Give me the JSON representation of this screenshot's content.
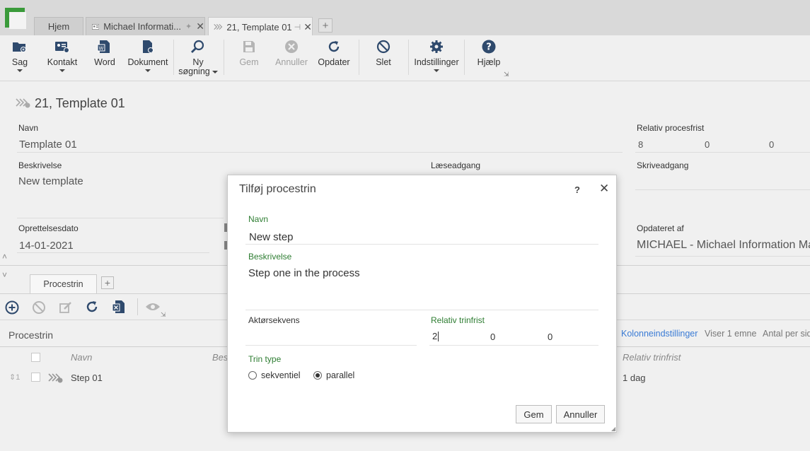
{
  "tabs": [
    {
      "label": "Hjem"
    },
    {
      "label": "Michael Informati..."
    },
    {
      "label": "21, Template 01"
    }
  ],
  "toolbar": {
    "sag": "Sag",
    "kontakt": "Kontakt",
    "word": "Word",
    "dokument": "Dokument",
    "ny_l1": "Ny",
    "ny_l2": "søgning",
    "gem": "Gem",
    "annuller": "Annuller",
    "opdater": "Opdater",
    "slet": "Slet",
    "indstillinger": "Indstillinger",
    "hjaelp": "Hjælp"
  },
  "record": {
    "title": "21, Template 01",
    "navn_label": "Navn",
    "navn_value": "Template 01",
    "beskrivelse_label": "Beskrivelse",
    "beskrivelse_value": "New template",
    "laeseadgang_label": "Læseadgang",
    "skriveadgang_label": "Skriveadgang",
    "relativ_label": "Relativ procesfrist",
    "relativ_values": [
      "8",
      "0",
      "0"
    ],
    "oprettelsesdato_label": "Oprettelsesdato",
    "oprettelsesdato_value": "14-01-2021",
    "opdateret_label": "Opdateret af",
    "opdateret_value": "MICHAEL - Michael Information Man"
  },
  "subtabs": {
    "procestrin": "Procestrin"
  },
  "grid": {
    "title": "Procestrin",
    "kolonne": "Kolonneindstillinger",
    "viser": "Viser 1 emne",
    "antal": "Antal per sid",
    "col_navn": "Navn",
    "col_besk": "Besk",
    "col_relativ": "Relativ trinfrist",
    "row_num": "1",
    "row_name": "Step 01",
    "row_relativ": "1 dag"
  },
  "dialog": {
    "title": "Tilføj procestrin",
    "help": "?",
    "navn_label": "Navn",
    "navn_value": "New step",
    "beskrivelse_label": "Beskrivelse",
    "beskrivelse_value": "Step one in the process",
    "aktor_label": "Aktørsekvens",
    "relativ_label": "Relativ trinfrist",
    "relativ_values": [
      "2",
      "0",
      "0"
    ],
    "trin_label": "Trin type",
    "opt_sekventiel": "sekventiel",
    "opt_parallel": "parallel",
    "selected": "parallel",
    "gem": "Gem",
    "annuller": "Annuller"
  },
  "colors": {
    "accent_green": "#2e7d32",
    "link_blue": "#3a7bd5"
  }
}
